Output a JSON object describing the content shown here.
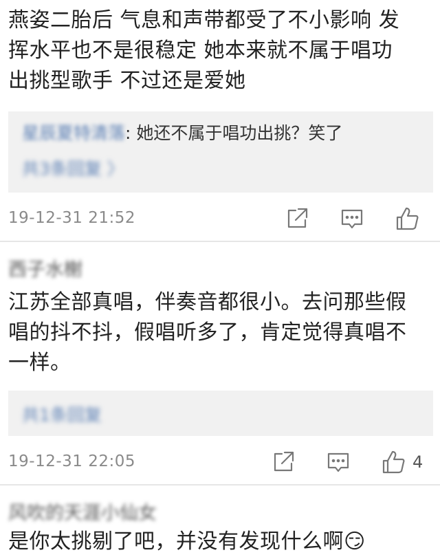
{
  "comments": [
    {
      "text_lines": [
        "燕姿二胎后 气息和声带都受了不小影响 发",
        "挥水平也不是很稳定 她本来就不属于唱功",
        "出挑型歌手 不过还是爱她"
      ],
      "reply": {
        "author": "星辰夏特清落",
        "sep": ": ",
        "text": "她还不属于唱功出挑？笑了",
        "count": "共3条回复 〉"
      },
      "timestamp": "19-12-31 21:52",
      "likes": ""
    },
    {
      "username": "西子水榭",
      "text_lines": [
        "江苏全部真唱，伴奏音都很小。去问那些假",
        "唱的抖不抖，假唱听多了，肯定觉得真唱不",
        "一样。"
      ],
      "reply": {
        "count": "共1条回复"
      },
      "timestamp": "19-12-31 22:05",
      "likes": "4"
    },
    {
      "username": "风吹的天涯小仙女",
      "text_lines": [
        "是你太挑剔了吧，并没有发现什么啊😏"
      ]
    }
  ],
  "icons": {
    "edit": "share-edit-icon",
    "comment": "comment-icon",
    "like": "thumbs-up-icon"
  },
  "colors": {
    "link": "#5b7fb4",
    "meta": "#8a8a8a",
    "reply_bg": "#f1f1f1"
  }
}
